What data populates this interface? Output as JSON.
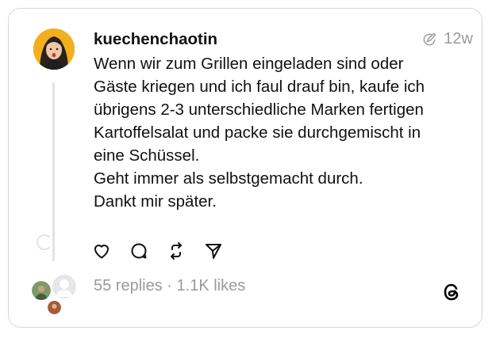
{
  "post": {
    "username": "kuechenchaotin",
    "age": "12w",
    "lines": [
      "Wenn wir zum Grillen eingeladen sind oder",
      "Gäste kriegen und ich faul drauf bin, kaufe ich",
      "übrigens 2-3 unterschiedliche Marken fertigen",
      "Kartoffelsalat und packe sie durchgemischt in",
      "eine Schüssel.",
      "Geht immer als selbstgemacht durch.",
      "Dankt mir später."
    ],
    "replies": "55 replies",
    "separator": "·",
    "likes": "1.1K likes"
  },
  "icons": {
    "edited": "edited-icon",
    "like": "heart-icon",
    "reply": "comment-icon",
    "repost": "repost-icon",
    "share": "send-icon",
    "brand": "threads-logo-icon"
  },
  "colors": {
    "avatar_bg": "#f2b01e",
    "muted_text": "#9a9a9a",
    "border": "#d8d8d8"
  }
}
